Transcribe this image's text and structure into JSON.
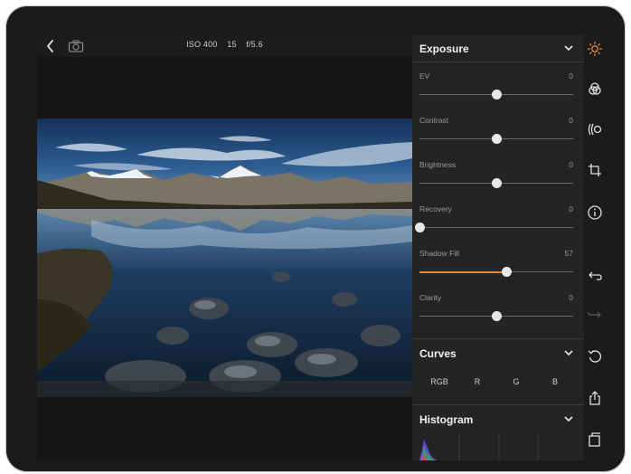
{
  "toolbar": {
    "back_icon": "chevron-left-icon",
    "camera_icon": "camera-icon",
    "iso": "ISO 400",
    "shutter": "15",
    "aperture": "f/5.6"
  },
  "exposure": {
    "title": "Exposure",
    "sliders": [
      {
        "label": "EV",
        "value": "0",
        "position": 0.5,
        "fill_from_left": false
      },
      {
        "label": "Contrast",
        "value": "0",
        "position": 0.5,
        "fill_from_left": false
      },
      {
        "label": "Brightness",
        "value": "0",
        "position": 0.5,
        "fill_from_left": false
      },
      {
        "label": "Recovery",
        "value": "0",
        "position": 0.0,
        "fill_from_left": false
      },
      {
        "label": "Shadow Fill",
        "value": "57",
        "position": 0.57,
        "fill_from_left": true
      },
      {
        "label": "Clarity",
        "value": "0",
        "position": 0.5,
        "fill_from_left": false
      }
    ]
  },
  "curves": {
    "title": "Curves",
    "channels": [
      "RGB",
      "R",
      "G",
      "B"
    ]
  },
  "histogram": {
    "title": "Histogram"
  },
  "rail_icons": [
    "sun-icon",
    "color-icon",
    "wave-icon",
    "crop-icon",
    "info-icon",
    "undo-icon",
    "redo-icon",
    "reset-icon",
    "share-icon",
    "copy-icon"
  ],
  "colors": {
    "accent": "#e08a3a",
    "panel_bg": "#242425",
    "rail_bg": "#1b1b1c"
  }
}
